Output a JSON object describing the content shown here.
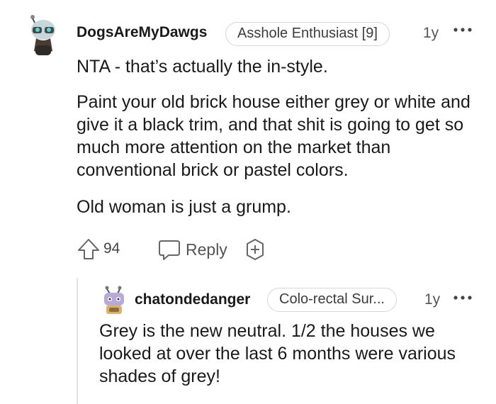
{
  "comment": {
    "username": "DogsAreMyDawgs",
    "flair": "Asshole Enthusiast [9]",
    "time": "1y",
    "paragraphs": [
      "NTA - that’s actually the in-style.",
      "Paint your old brick house either grey or white and give it a black trim, and that shit is going to get so much more attention on the market than conventional brick or pastel colors.",
      "Old woman is just a grump."
    ],
    "votes": "94",
    "reply_label": "Reply",
    "icons": {
      "more": "more-dots-icon",
      "upvote": "upvote-arrow-icon",
      "reply": "speech-bubble-icon",
      "award": "award-plus-icon"
    }
  },
  "reply": {
    "username": "chatondedanger",
    "flair": "Colo-rectal Sur...",
    "time": "1y",
    "text": "Grey is the new neutral. 1/2 the houses we looked at over the last 6 months were various shades of grey!"
  },
  "colors": {
    "text": "#1a1a1b",
    "muted": "#555555",
    "flair_border": "#d6d6d6",
    "thread_line": "#e3e3e3"
  }
}
